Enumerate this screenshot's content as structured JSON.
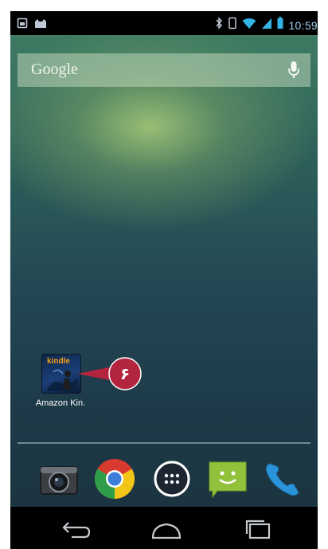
{
  "status_bar": {
    "time": "10:59",
    "left_icons": [
      "screenshot-icon",
      "cat-icon"
    ],
    "right_icons": [
      "bluetooth-icon",
      "vibrate-icon",
      "wifi-icon",
      "signal-icon",
      "battery-icon"
    ]
  },
  "search": {
    "label": "Google",
    "icon": "mic-icon"
  },
  "home_apps": [
    {
      "label": "Amazon Kin.",
      "icon": "kindle-app-icon",
      "icon_text": "kindle"
    }
  ],
  "callout": {
    "text": "۶",
    "color": "#b3243e"
  },
  "dock": {
    "apps": [
      "camera-app-icon",
      "chrome-app-icon",
      "app-drawer-icon",
      "messaging-app-icon",
      "phone-app-icon"
    ]
  },
  "navigation": {
    "buttons": [
      "back-icon",
      "home-icon",
      "recents-icon"
    ]
  }
}
